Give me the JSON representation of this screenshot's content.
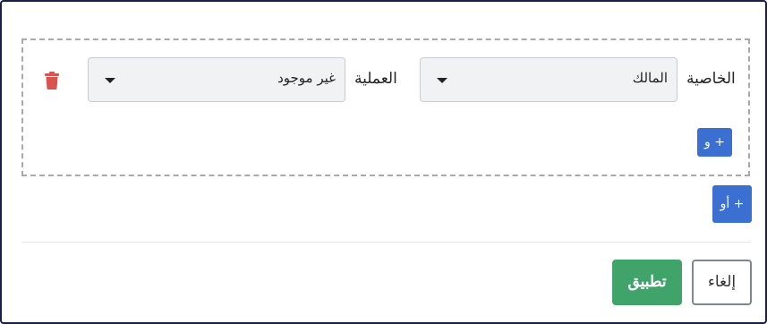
{
  "filter": {
    "row": {
      "property_label": "الخاصية",
      "property_value": "المالك",
      "operation_label": "العملية",
      "operation_value": "غير موجود"
    },
    "and_button": "+ و",
    "or_button": "+ أو"
  },
  "footer": {
    "apply": "تطبيق",
    "cancel": "إلغاء"
  },
  "colors": {
    "accent_blue": "#3b6fd1",
    "apply_green": "#3fa36a",
    "delete_red": "#d9534f",
    "frame_border": "#1a1f4a"
  },
  "icons": {
    "delete": "trash-icon",
    "dropdown": "caret-down-icon"
  }
}
